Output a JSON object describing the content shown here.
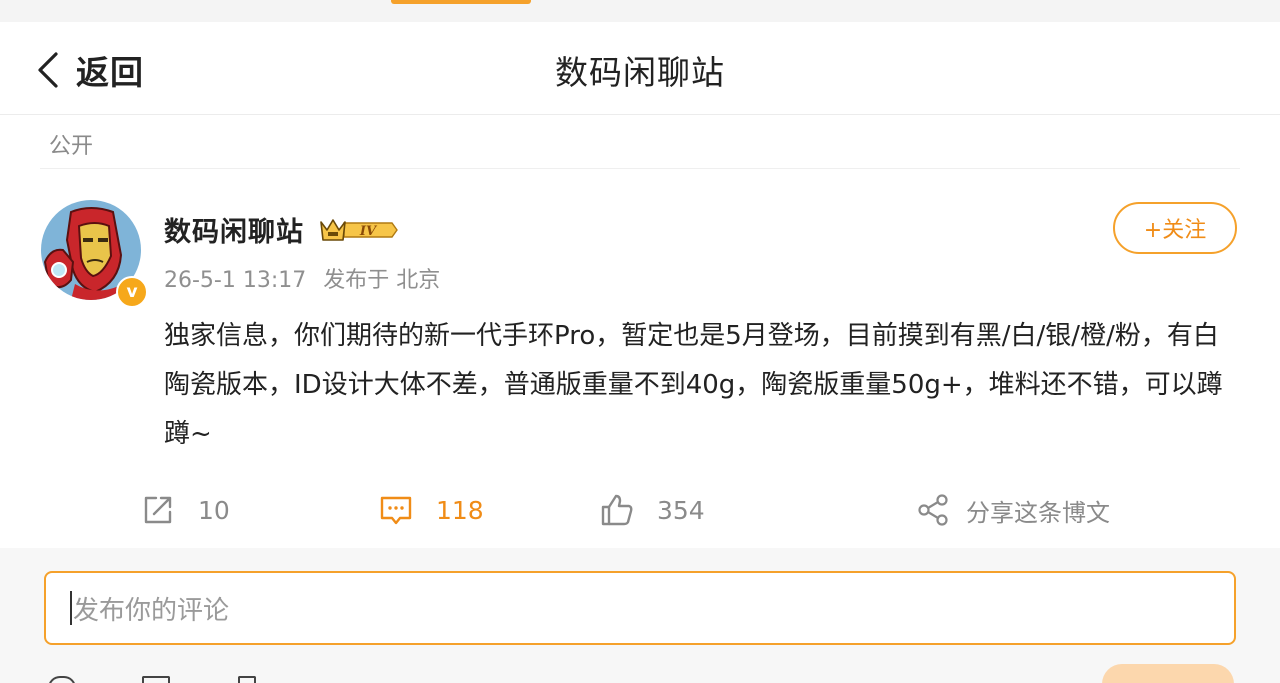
{
  "header": {
    "back_label": "返回",
    "title": "数码闲聊站"
  },
  "visibility": "公开",
  "post": {
    "author": "数码闲聊站",
    "level_badge": "IV",
    "date": "26-5-1 13:17",
    "location": "发布于 北京",
    "follow_label": "+关注",
    "text": "独家信息，你们期待的新一代手环Pro，暂定也是5月登场，目前摸到有黑/白/银/橙/粉，有白陶瓷版本，ID设计大体不差，普通版重量不到40g，陶瓷版重量50g+，堆料还不错，可以蹲蹲~",
    "verified_badge": "v"
  },
  "actions": {
    "repost_count": "10",
    "comment_count": "118",
    "like_count": "354",
    "share_label": "分享这条博文"
  },
  "comment": {
    "placeholder": "发布你的评论"
  },
  "colors": {
    "accent": "#f5a12b",
    "accent_text": "#f08c17",
    "muted": "#8a8a8a"
  },
  "icons": {
    "back": "chevron-left-icon",
    "repost": "repost-icon",
    "comment": "comment-icon",
    "like": "thumbs-up-icon",
    "share": "share-icon"
  }
}
